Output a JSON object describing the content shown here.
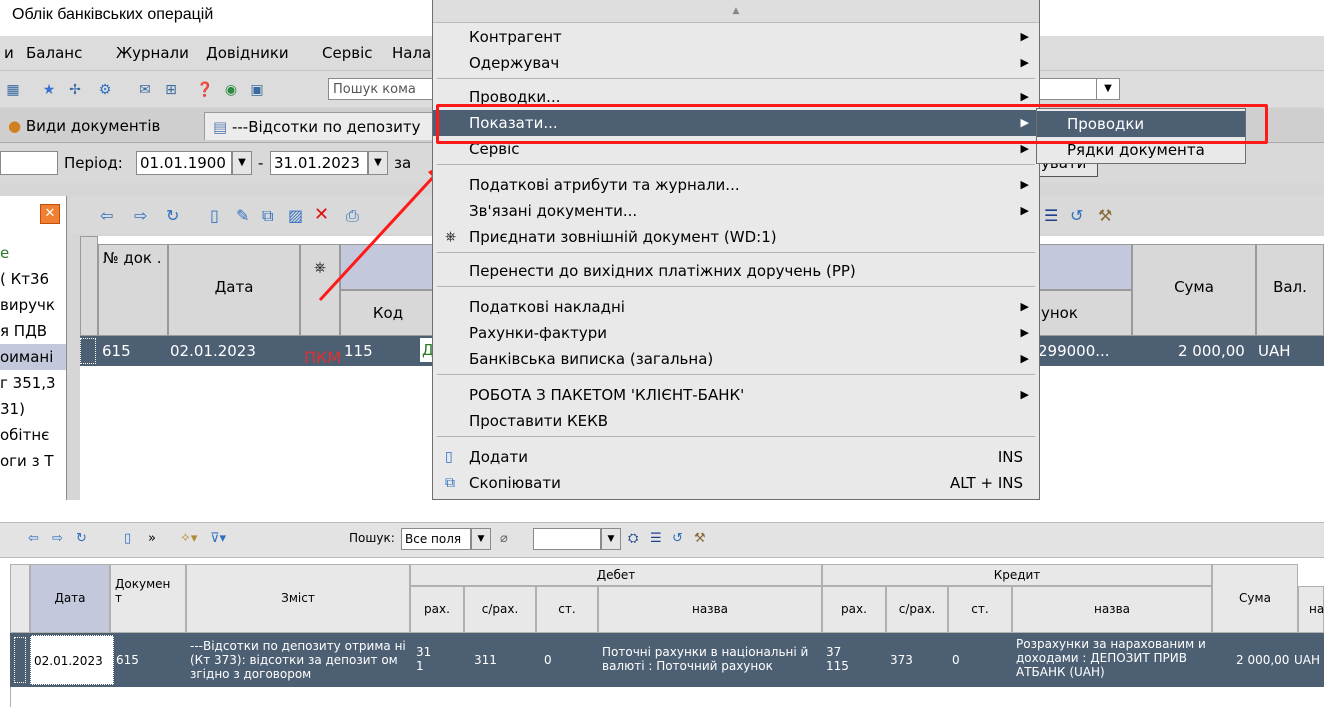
{
  "app_title": "Облік банківських операцій",
  "menubar": [
    "и",
    "Баланс",
    "Журнали",
    "Довідники",
    "Сервіс",
    "Нала"
  ],
  "toolbar": {
    "search_placeholder": "Пошук кома"
  },
  "tabs": [
    "Види документів",
    "---Відсотки по депозиту"
  ],
  "period": {
    "label": "Період:",
    "from": "01.01.1900",
    "dash": "-",
    "to": "31.01.2023",
    "suffix": "за",
    "right_text": "увати"
  },
  "left_pane": [
    "е",
    "( Кт36",
    "виручк",
    "я ПДВ",
    "оимані",
    "г 351,3",
    "31)",
    "обітнє",
    "оги з Т"
  ],
  "grid": {
    "headers": {
      "doc_no": "№ док .",
      "date": "Дата",
      "code": "Код",
      "account": "унок",
      "sum": "Сума",
      "currency": "Вал."
    },
    "row": {
      "doc_no": "615",
      "date": "02.01.2023",
      "code": "115",
      "code_extra": "Д",
      "account": "299000...",
      "sum": "2 000,00",
      "currency": "UAH"
    }
  },
  "annotation": "ПКМ",
  "context_menu": {
    "items": [
      {
        "label": "Контрагент",
        "arrow": "▶"
      },
      {
        "label": "Одержувач",
        "arrow": "▶"
      },
      {
        "label": "Проводки...",
        "arrow": "▶"
      },
      {
        "label": "Показати...",
        "arrow": "▶"
      },
      {
        "label": "Сервіс",
        "arrow": "▶"
      },
      {
        "label": "Податкові атрибути та журнали...",
        "arrow": "▶"
      },
      {
        "label": "Зв'язані документи...",
        "arrow": "▶"
      },
      {
        "label": "Приєднати зовнішній документ (WD:1)"
      },
      {
        "label": "Перенести до вихідних платіжних доручень (PP)"
      },
      {
        "label": "Податкові накладні",
        "arrow": "▶"
      },
      {
        "label": "Рахунки-фактури",
        "arrow": "▶"
      },
      {
        "label": "Банківська виписка (загальна)",
        "arrow": "▶"
      },
      {
        "label": "РОБОТА З ПАКЕТОМ 'КЛІЄНТ-БАНК'",
        "arrow": "▶"
      },
      {
        "label": "Проставити КЕКВ"
      },
      {
        "label": "Додати",
        "shortcut": "INS"
      },
      {
        "label": "Скопіювати",
        "shortcut": "ALT + INS"
      }
    ]
  },
  "submenu": [
    "Проводки",
    "Рядки документа"
  ],
  "bottom": {
    "search_label": "Пошук:",
    "search_field": "Все поля",
    "headers": {
      "date": "Дата",
      "document": "Докумен т",
      "content": "Зміст",
      "debit": "Дебет",
      "credit": "Кредит",
      "acc": "рах.",
      "subacc": "с/рах.",
      "art": "ст.",
      "name": "назва",
      "sum": "Сума",
      "extra": "на"
    },
    "row": {
      "date": "02.01.2023",
      "document": "615",
      "content": "---Відсотки по депозиту отрима ні (Кт 373): відсотки за депозит ом згідно з договором",
      "debit_acc": "31 1",
      "debit_subacc": "311",
      "debit_art": "0",
      "debit_name": "Поточні рахунки в національні й валюті : Поточний рахунок",
      "credit_acc": "37 115",
      "credit_subacc": "373",
      "credit_art": "0",
      "credit_name": "Розрахунки за нарахованим и доходами : ДЕПОЗИТ ПРИВ АТБАНК (UAH)",
      "sum": "2 000,00",
      "cur": "UAH"
    }
  }
}
